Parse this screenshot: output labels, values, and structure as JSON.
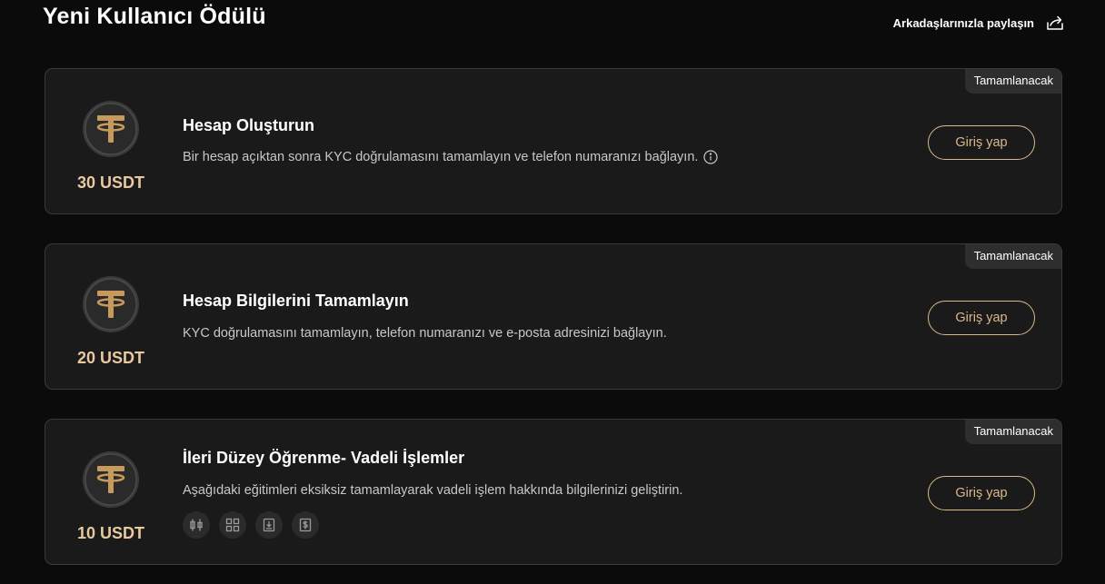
{
  "header": {
    "title": "Yeni Kullanıcı Ödülü",
    "share_label": "Arkadaşlarınızla paylaşın"
  },
  "colors": {
    "background": "#0b0b0b",
    "card": "#1a1a1a",
    "accent_gold": "#d9b98a",
    "reward_text": "#e8c9a0"
  },
  "tasks": [
    {
      "status": "Tamamlanacak",
      "reward": "30 USDT",
      "title": "Hesap Oluşturun",
      "description": "Bir hesap açıktan sonra KYC doğrulamasını tamamlayın ve telefon numaranızı bağlayın.",
      "has_info_icon": true,
      "button_label": "Giriş yap"
    },
    {
      "status": "Tamamlanacak",
      "reward": "20 USDT",
      "title": "Hesap Bilgilerini Tamamlayın",
      "description": "KYC doğrulamasını tamamlayın, telefon numaranızı ve e-posta adresinizi bağlayın.",
      "button_label": "Giriş yap"
    },
    {
      "status": "Tamamlanacak",
      "reward": "10 USDT",
      "title": "İleri Düzey Öğrenme- Vadeli İşlemler",
      "description": "Aşağıdaki eğitimleri eksiksiz tamamlayarak vadeli işlem hakkında bilgilerinizi geliştirin.",
      "button_label": "Giriş yap",
      "course_icons": [
        "candlestick-icon",
        "grid-icon",
        "book-download-icon",
        "dollar-doc-icon"
      ]
    }
  ]
}
